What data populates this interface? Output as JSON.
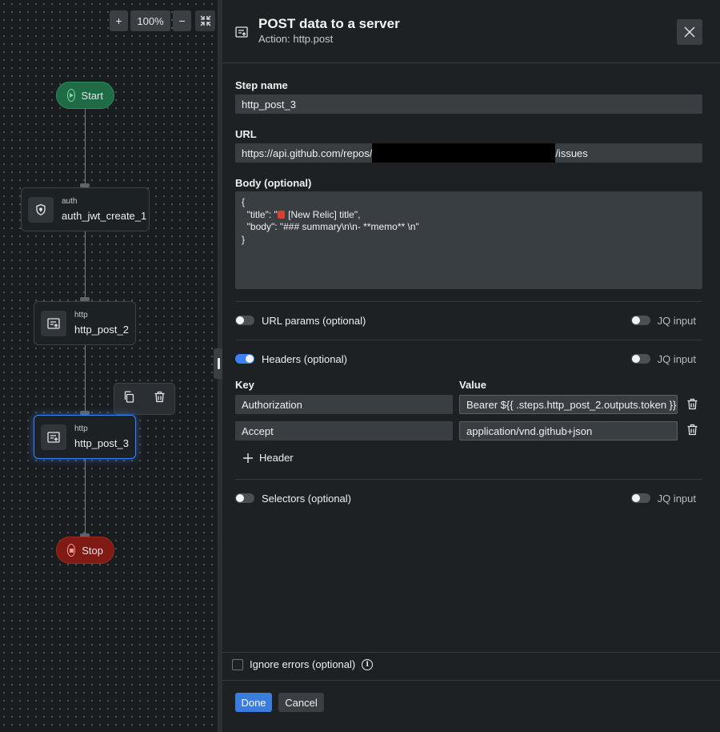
{
  "canvas": {
    "zoom": {
      "plus_label": "+",
      "level": "100%",
      "minus_label": "−"
    },
    "start_label": "Start",
    "stop_label": "Stop",
    "nodes": [
      {
        "type": "auth",
        "name": "auth_jwt_create_1",
        "icon": "shield-icon"
      },
      {
        "type": "http",
        "name": "http_post_2",
        "icon": "http-request-icon"
      },
      {
        "type": "http",
        "name": "http_post_3",
        "icon": "http-request-icon",
        "selected": true
      }
    ],
    "node_toolbar": {
      "icons": [
        "copy-icon",
        "trash-icon"
      ]
    }
  },
  "panel": {
    "title": "POST data to a server",
    "subtitle": "Action: http.post",
    "step_name_label": "Step name",
    "step_name_value": "http_post_3",
    "url_label": "URL",
    "url_prefix": "https://api.github.com/repos/",
    "url_suffix": "/issues",
    "body_label": "Body (optional)",
    "body_lines": {
      "l1": "{",
      "l2_pre": "  \"title\": \"",
      "l2_post": " [New Relic] title\",",
      "l3": "  \"body\": \"### summary\\n\\n- **memo** \\n\"",
      "l4": "}"
    },
    "url_params_label": "URL params (optional)",
    "headers_label": "Headers (optional)",
    "selectors_label": "Selectors (optional)",
    "jq_label": "JQ input",
    "key_label": "Key",
    "value_label": "Value",
    "headers": [
      {
        "key": "Authorization",
        "value": "Bearer ${{ .steps.http_post_2.outputs.token }}"
      },
      {
        "key": "Accept",
        "value": "application/vnd.github+json"
      }
    ],
    "add_header_label": "Header",
    "ignore_errors_label": "Ignore errors (optional)",
    "done_label": "Done",
    "cancel_label": "Cancel",
    "accent_color": "#3b82f6"
  }
}
